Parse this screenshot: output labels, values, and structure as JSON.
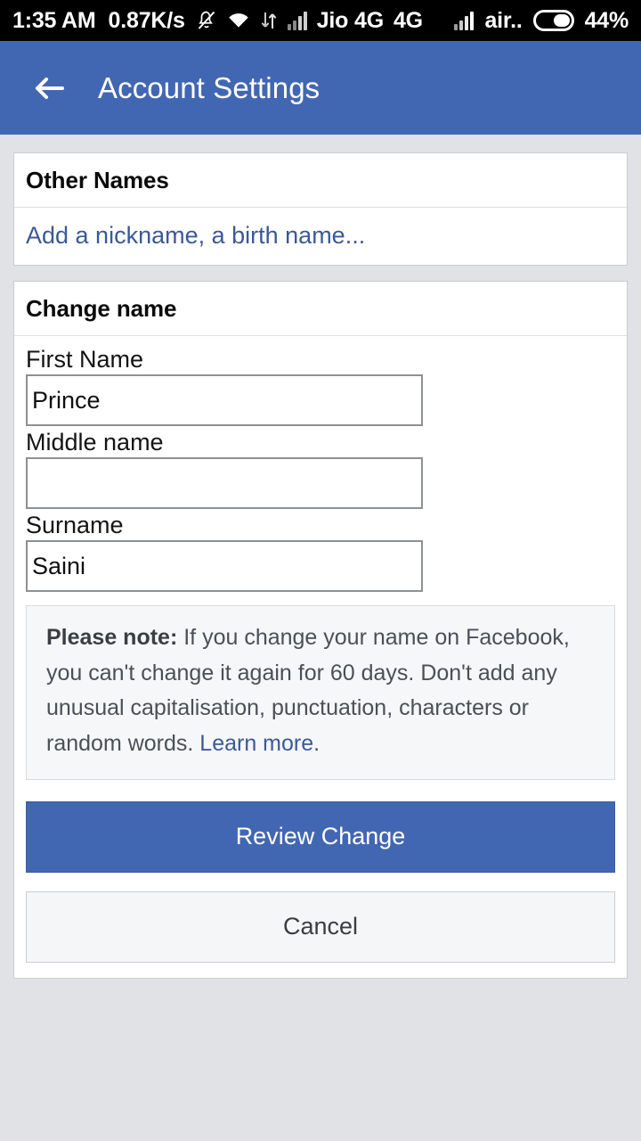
{
  "status_bar": {
    "time": "1:35 AM",
    "network_speed": "0.87K/s",
    "mute_icon": "bell-muted-icon",
    "wifi_icon": "wifi-icon",
    "data_transfer_icon": "data-transfer-icon",
    "signal1_icon": "signal-bars-icon",
    "carrier1": "Jio 4G",
    "network_type": "4G",
    "signal2_icon": "signal-bars-icon",
    "carrier2": "air..",
    "battery_icon": "battery-icon",
    "battery_percent": "44%"
  },
  "app_bar": {
    "back_icon": "back-arrow-icon",
    "title": "Account Settings"
  },
  "other_names_card": {
    "header": "Other Names",
    "add_link": "Add a nickname, a birth name..."
  },
  "change_name_card": {
    "header": "Change name",
    "fields": [
      {
        "label": "First Name",
        "value": "Prince",
        "placeholder": ""
      },
      {
        "label": "Middle name",
        "value": "",
        "placeholder": ""
      },
      {
        "label": "Surname",
        "value": "Saini",
        "placeholder": ""
      }
    ],
    "note": {
      "prefix": "Please note:",
      "body": " If you change your name on Facebook, you can't change it again for 60 days. Don't add any unusual capitalisation, punctuation, characters or random words. ",
      "link": "Learn more",
      "suffix": "."
    },
    "primary_button": "Review Change",
    "secondary_button": "Cancel"
  },
  "colors": {
    "brand_blue": "#4267b2",
    "link_blue": "#3b5998",
    "page_background": "#e0e2e5",
    "card_background": "#ffffff",
    "note_background": "#f6f7f9",
    "cancel_background": "#f5f6f7",
    "status_bar_background": "#000000"
  }
}
